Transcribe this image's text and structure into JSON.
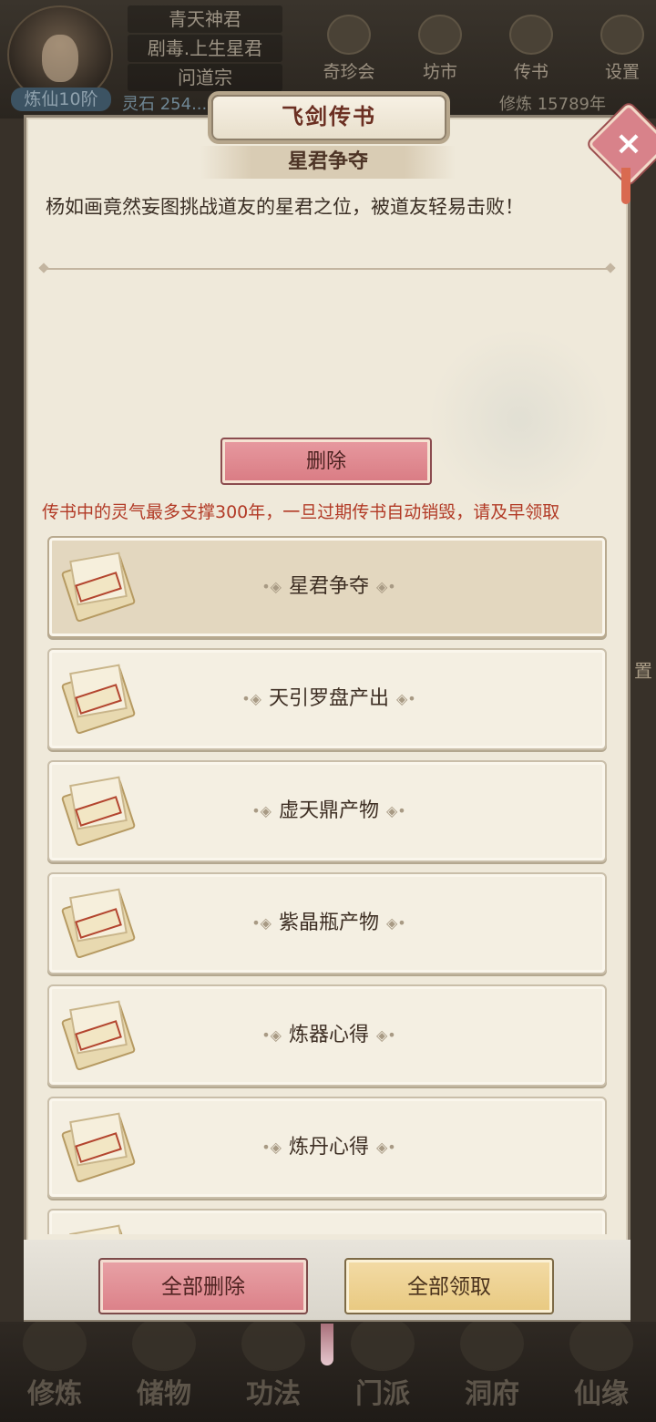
{
  "header": {
    "player_lines": [
      "青天神君",
      "剧毒.上生星君",
      "问道宗"
    ],
    "level": "炼仙10阶",
    "spirit_stone": "灵石 254...",
    "cultivation": "修炼 15789年"
  },
  "top_nav": [
    {
      "label": "奇珍会",
      "icon": "treasure-icon"
    },
    {
      "label": "坊市",
      "icon": "market-icon"
    },
    {
      "label": "传书",
      "icon": "letter-icon"
    },
    {
      "label": "设置",
      "icon": "gear-icon"
    }
  ],
  "side": {
    "right_label": "置"
  },
  "dialog": {
    "title": "飞剑传书",
    "subtitle": "星君争夺",
    "message": "杨如画竟然妄图挑战道友的星君之位，被道友轻易击败！",
    "delete_label": "删除",
    "warning": "传书中的灵气最多支撑300年，一旦过期传书自动销毁，请及早领取",
    "items": [
      {
        "title": "星君争夺",
        "selected": true
      },
      {
        "title": "天引罗盘产出",
        "selected": false
      },
      {
        "title": "虚天鼎产物",
        "selected": false
      },
      {
        "title": "紫晶瓶产物",
        "selected": false
      },
      {
        "title": "炼器心得",
        "selected": false
      },
      {
        "title": "炼丹心得",
        "selected": false
      }
    ],
    "delete_all_label": "全部删除",
    "claim_all_label": "全部领取",
    "close_icon": "close-icon"
  },
  "bottom_nav": [
    "修炼",
    "储物",
    "功法",
    "门派",
    "洞府",
    "仙缘"
  ],
  "colors": {
    "dialog_bg": "#efe9da",
    "title_text": "#6b2f22",
    "warning_text": "#b23a26",
    "delete_button": "#db8088",
    "claim_button": "#e8c980"
  }
}
